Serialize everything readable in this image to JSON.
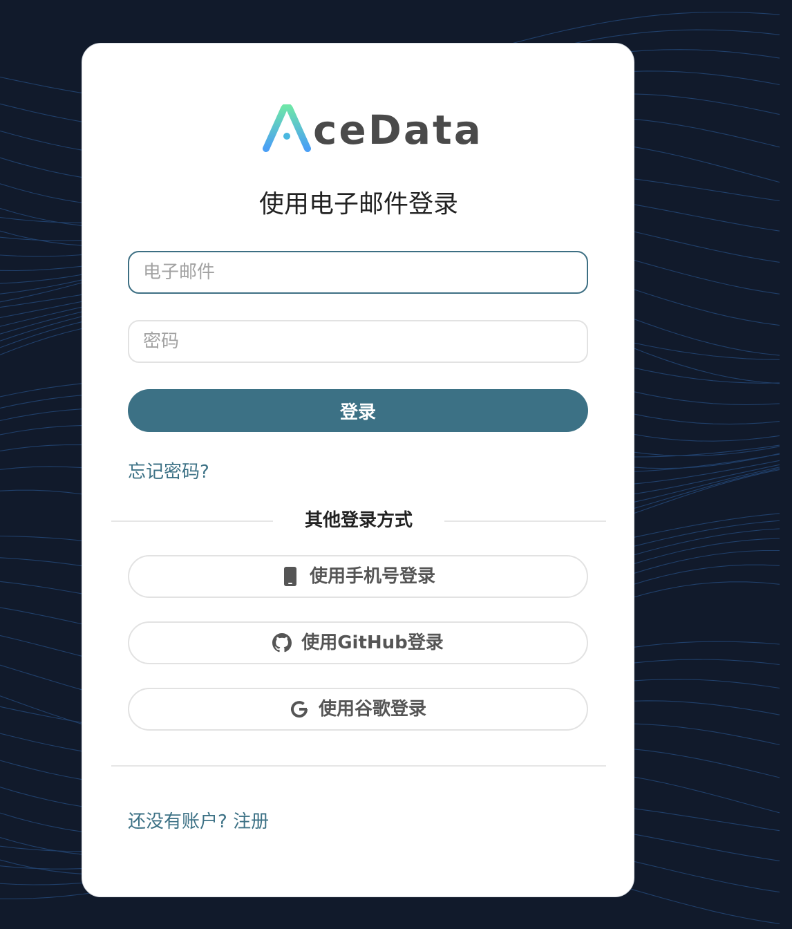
{
  "brand": {
    "name": "AceData",
    "logo_text": "ceData",
    "logo_icon": "stylized-letter-a-icon",
    "accent_gradient": [
      "#6ee6a8",
      "#4a9ff5"
    ],
    "text_color": "#4a4a4a"
  },
  "page": {
    "title": "使用电子邮件登录"
  },
  "form": {
    "email_placeholder": "电子邮件",
    "email_value": "",
    "password_placeholder": "密码",
    "password_value": "",
    "login_label": "登录",
    "forgot_password_label": "忘记密码?"
  },
  "alt_login": {
    "divider_label": "其他登录方式",
    "options": [
      {
        "label": "使用手机号登录",
        "icon": "mobile-phone-icon"
      },
      {
        "label": "使用GitHub登录",
        "icon": "github-icon"
      },
      {
        "label": "使用谷歌登录",
        "icon": "google-icon"
      }
    ]
  },
  "signup": {
    "prompt": "还没有账户?",
    "link_label": "注册"
  },
  "colors": {
    "primary": "#3c7185",
    "background": "#111a2b",
    "card": "#ffffff"
  }
}
